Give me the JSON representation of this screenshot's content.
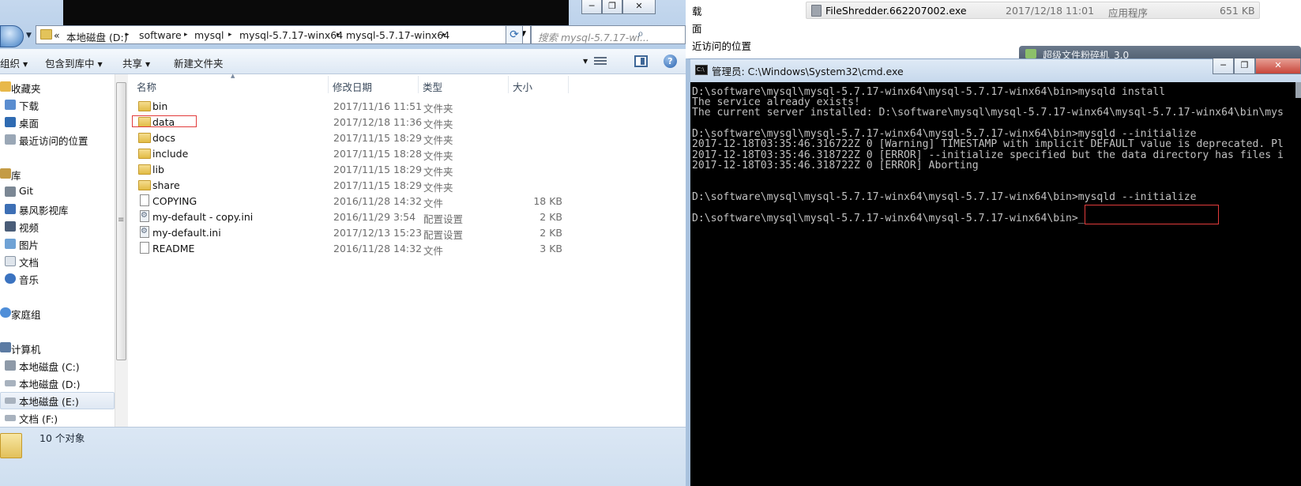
{
  "background_window": {
    "file_row": {
      "name": "FileShredder.662207002.exe",
      "date": "2017/12/18 11:01",
      "type": "应用程序",
      "size": "651 KB"
    },
    "side_items": [
      "载",
      "面",
      "近访问的位置"
    ],
    "taskbar_label": "超级文件粉碎机_3.0"
  },
  "explorer": {
    "address": {
      "prefix": "«",
      "crumbs": [
        "本地磁盘 (D:)",
        "software",
        "mysql",
        "mysql-5.7.17-winx64",
        "mysql-5.7.17-winx64"
      ]
    },
    "search_placeholder": "搜索 mysql-5.7.17-wi...",
    "toolbar": {
      "organize": "组织",
      "include_in_library": "包含到库中",
      "share": "共享",
      "new_folder": "新建文件夹"
    },
    "nav": {
      "favorites": "收藏夹",
      "downloads": "下载",
      "desktop": "桌面",
      "recent": "最近访问的位置",
      "libraries": "库",
      "git": "Git",
      "storm": "暴风影视库",
      "video": "视频",
      "pictures": "图片",
      "documents": "文档",
      "music": "音乐",
      "homegroup": "家庭组",
      "computer": "计算机",
      "drive_c": "本地磁盘 (C:)",
      "drive_d": "本地磁盘 (D:)",
      "drive_e": "本地磁盘 (E:)",
      "drive_f": "文档 (F:)"
    },
    "columns": {
      "name": "名称",
      "date": "修改日期",
      "type": "类型",
      "size": "大小"
    },
    "files": [
      {
        "name": "bin",
        "date": "2017/11/16 11:51",
        "type": "文件夹",
        "size": "",
        "kind": "folder"
      },
      {
        "name": "data",
        "date": "2017/12/18 11:36",
        "type": "文件夹",
        "size": "",
        "kind": "folder"
      },
      {
        "name": "docs",
        "date": "2017/11/15 18:29",
        "type": "文件夹",
        "size": "",
        "kind": "folder"
      },
      {
        "name": "include",
        "date": "2017/11/15 18:28",
        "type": "文件夹",
        "size": "",
        "kind": "folder"
      },
      {
        "name": "lib",
        "date": "2017/11/15 18:29",
        "type": "文件夹",
        "size": "",
        "kind": "folder"
      },
      {
        "name": "share",
        "date": "2017/11/15 18:29",
        "type": "文件夹",
        "size": "",
        "kind": "folder"
      },
      {
        "name": "COPYING",
        "date": "2016/11/28 14:32",
        "type": "文件",
        "size": "18 KB",
        "kind": "file"
      },
      {
        "name": "my-default - copy.ini",
        "date": "2016/11/29 3:54",
        "type": "配置设置",
        "size": "2 KB",
        "kind": "ini"
      },
      {
        "name": "my-default.ini",
        "date": "2017/12/13 15:23",
        "type": "配置设置",
        "size": "2 KB",
        "kind": "ini"
      },
      {
        "name": "README",
        "date": "2016/11/28 14:32",
        "type": "文件",
        "size": "3 KB",
        "kind": "file"
      }
    ],
    "status": "10 个对象"
  },
  "cmd": {
    "title": "管理员: C:\\Windows\\System32\\cmd.exe",
    "lines": [
      "D:\\software\\mysql\\mysql-5.7.17-winx64\\mysql-5.7.17-winx64\\bin>mysqld install",
      "The service already exists!",
      "The current server installed: D:\\software\\mysql\\mysql-5.7.17-winx64\\mysql-5.7.17-winx64\\bin\\mys",
      "",
      "D:\\software\\mysql\\mysql-5.7.17-winx64\\mysql-5.7.17-winx64\\bin>mysqld --initialize",
      "2017-12-18T03:35:46.316722Z 0 [Warning] TIMESTAMP with implicit DEFAULT value is deprecated. Pl",
      "2017-12-18T03:35:46.318722Z 0 [ERROR] --initialize specified but the data directory has files i",
      "2017-12-18T03:35:46.318722Z 0 [ERROR] Aborting",
      "",
      "",
      "D:\\software\\mysql\\mysql-5.7.17-winx64\\mysql-5.7.17-winx64\\bin>mysqld --initialize",
      "",
      "D:\\software\\mysql\\mysql-5.7.17-winx64\\mysql-5.7.17-winx64\\bin>_"
    ]
  }
}
